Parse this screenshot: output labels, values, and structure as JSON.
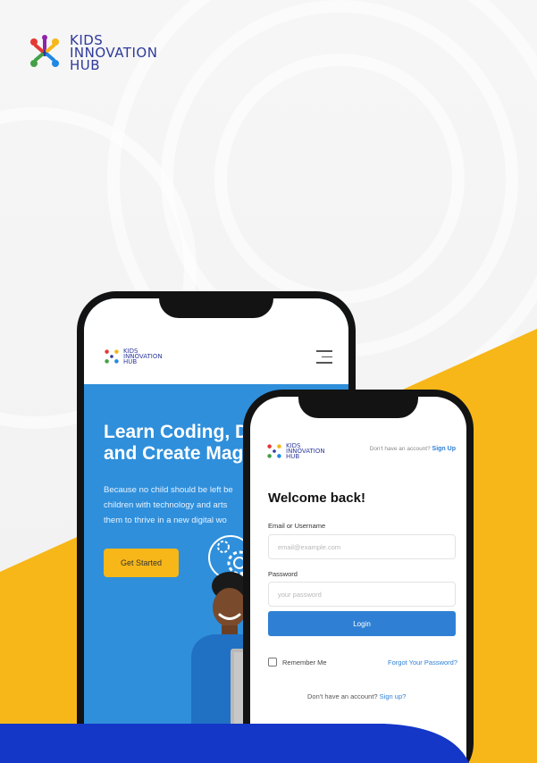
{
  "brand": {
    "line1": "KIDS",
    "line2": "INNOVATION",
    "line3": "HUB",
    "text_color": "#2e3a9b"
  },
  "colors": {
    "accent_yellow": "#f7b718",
    "hero_blue": "#2f8fdb",
    "link_blue": "#2f80d4",
    "band_blue": "#1437c8",
    "phone_frame": "#131313"
  },
  "landing_phone": {
    "logo": {
      "line1": "KIDS",
      "line2": "INNOVATION",
      "line3": "HUB"
    },
    "menu_icon": "hamburger-menu-icon",
    "hero_title_line1": "Learn Coding, D",
    "hero_title_line2": "and Create Mag",
    "hero_sub_line1": "Because no child should be left be",
    "hero_sub_line2": "children with technology and arts",
    "hero_sub_line3": "them to thrive in a new digital wo",
    "cta_label": "Get Started"
  },
  "login_phone": {
    "logo": {
      "line1": "KIDS",
      "line2": "INNOVATION",
      "line3": "HUB"
    },
    "signup_prompt": "Don't have an account?",
    "signup_link": "Sign Up",
    "welcome": "Welcome back!",
    "email_label": "Email or Username",
    "email_placeholder": "email@example.com",
    "password_label": "Password",
    "password_placeholder": "your password",
    "login_label": "Login",
    "remember_label": "Remember Me",
    "forgot_label": "Forgot Your Password?",
    "bottom_prompt": "Don't have an account?",
    "bottom_link": "Sign up?"
  }
}
